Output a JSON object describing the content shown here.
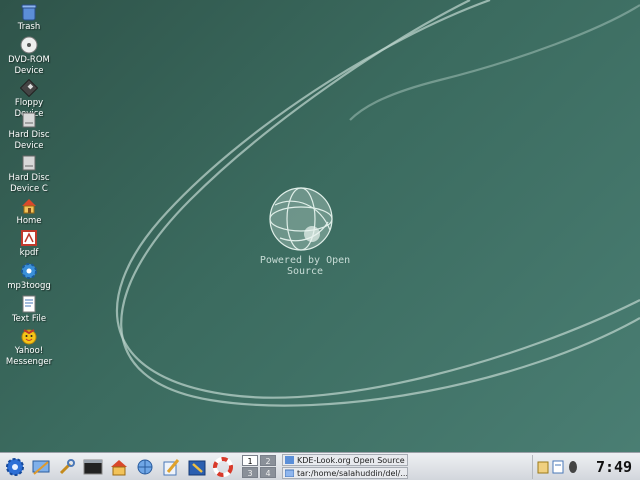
{
  "wallpaper": {
    "caption": "Powered by Open Source"
  },
  "desktop_icons": [
    {
      "label": "Trash",
      "icon": "trash-icon"
    },
    {
      "label": "DVD-ROM Device",
      "icon": "dvd-icon"
    },
    {
      "label": "Floppy Device",
      "icon": "floppy-icon"
    },
    {
      "label": "Hard Disc Device",
      "icon": "harddisk-icon"
    },
    {
      "label": "Hard Disc Device C",
      "icon": "harddisk-icon"
    },
    {
      "label": "Home",
      "icon": "home-icon"
    },
    {
      "label": "kpdf",
      "icon": "pdf-icon"
    },
    {
      "label": "mp3toogg",
      "icon": "gear-icon"
    },
    {
      "label": "Text File",
      "icon": "text-file-icon"
    },
    {
      "label": "Yahoo! Messenger",
      "icon": "yahoo-messenger-icon"
    }
  ],
  "taskbar": {
    "launchers": [
      {
        "icon": "kde-menu-icon"
      },
      {
        "icon": "desktop-icon"
      },
      {
        "icon": "settings-wrench-icon"
      },
      {
        "icon": "terminal-icon"
      },
      {
        "icon": "home-folder-icon"
      },
      {
        "icon": "network-icon"
      },
      {
        "icon": "editor-icon"
      },
      {
        "icon": "install-icon"
      },
      {
        "icon": "help-lifebuoy-icon"
      }
    ],
    "pager": [
      "1",
      "2",
      "3",
      "4"
    ],
    "active_desktop": "1",
    "tasks": [
      {
        "label": "KDE-Look.org Open Source"
      },
      {
        "label": "tar:/home/salahuddin/del/..."
      }
    ],
    "clock": "7:49"
  },
  "colors": {
    "desktop_dark": "#2f544a",
    "desktop_light": "#4a7e73",
    "taskbar": "#dfe2e7"
  }
}
